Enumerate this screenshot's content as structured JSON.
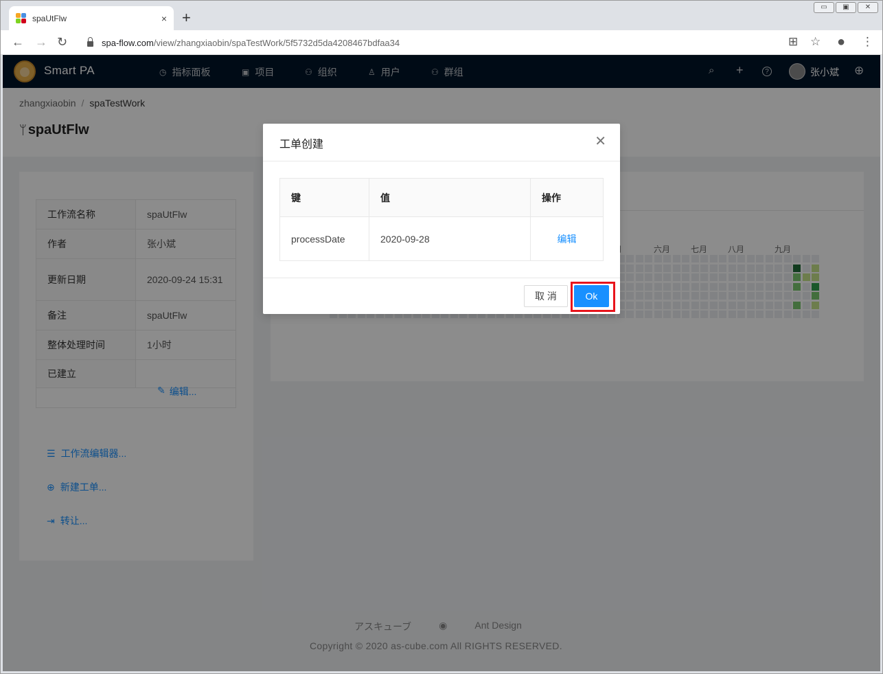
{
  "browser": {
    "tab_title": "spaUtFlw",
    "tab_close": "×",
    "new_tab": "+",
    "url_host": "spa-flow.com",
    "url_path": "/view/zhangxiaobin/spaTestWork/5f5732d5da4208467bdfaa34",
    "back": "←",
    "forward": "→",
    "reload": "↻",
    "win_min": "▭",
    "win_restore": "▣",
    "win_close": "✕",
    "translate": "⊞",
    "star": "☆",
    "profile": "●",
    "menu": "⋮"
  },
  "header": {
    "brand": "Smart PA",
    "menu": [
      {
        "icon": "◷",
        "label": "指标面板"
      },
      {
        "icon": "▣",
        "label": "项目"
      },
      {
        "icon": "⚇",
        "label": "组织"
      },
      {
        "icon": "♙",
        "label": "用户"
      },
      {
        "icon": "⚇",
        "label": "群组"
      }
    ],
    "search": "⌕",
    "add": "+",
    "help": "?",
    "username": "张小斌",
    "globe": "⊕"
  },
  "breadcrumb": {
    "root": "zhangxiaobin",
    "sep": "/",
    "current": "spaTestWork"
  },
  "page_title": "spaUtFlw",
  "branch_icon": "ᛘ",
  "details": [
    {
      "key": "工作流名称",
      "value": "spaUtFlw"
    },
    {
      "key": "作者",
      "value": "张小斌"
    },
    {
      "key": "更新日期",
      "value": "2020-09-24 15:31"
    },
    {
      "key": "备注",
      "value": "spaUtFlw"
    },
    {
      "key": "整体处理时间",
      "value": "1小时"
    },
    {
      "key": "已建立",
      "value": ""
    }
  ],
  "edit_link": {
    "icon": "✎",
    "label": "编辑..."
  },
  "actions": [
    {
      "icon": "☰",
      "label": "工作流编辑器..."
    },
    {
      "icon": "⊕",
      "label": "新建工单..."
    },
    {
      "icon": "⇥",
      "label": "转让..."
    }
  ],
  "calendar": {
    "months": [
      "月",
      "六月",
      "七月",
      "八月",
      "九月"
    ]
  },
  "footer": {
    "links": [
      "アスキューブ",
      "◉",
      "Ant Design"
    ],
    "copyright": "Copyright © 2020 as-cube.com All RIGHTS RESERVED."
  },
  "modal": {
    "title": "工单创建",
    "close": "✕",
    "columns": [
      "键",
      "值",
      "操作"
    ],
    "rows": [
      {
        "key": "processDate",
        "value": "2020-09-28",
        "action": "编辑"
      }
    ],
    "cancel": "取 消",
    "ok": "Ok"
  },
  "colors": {
    "primary": "#1890ff",
    "header_bg": "#001529",
    "highlight": "#e8141b"
  }
}
